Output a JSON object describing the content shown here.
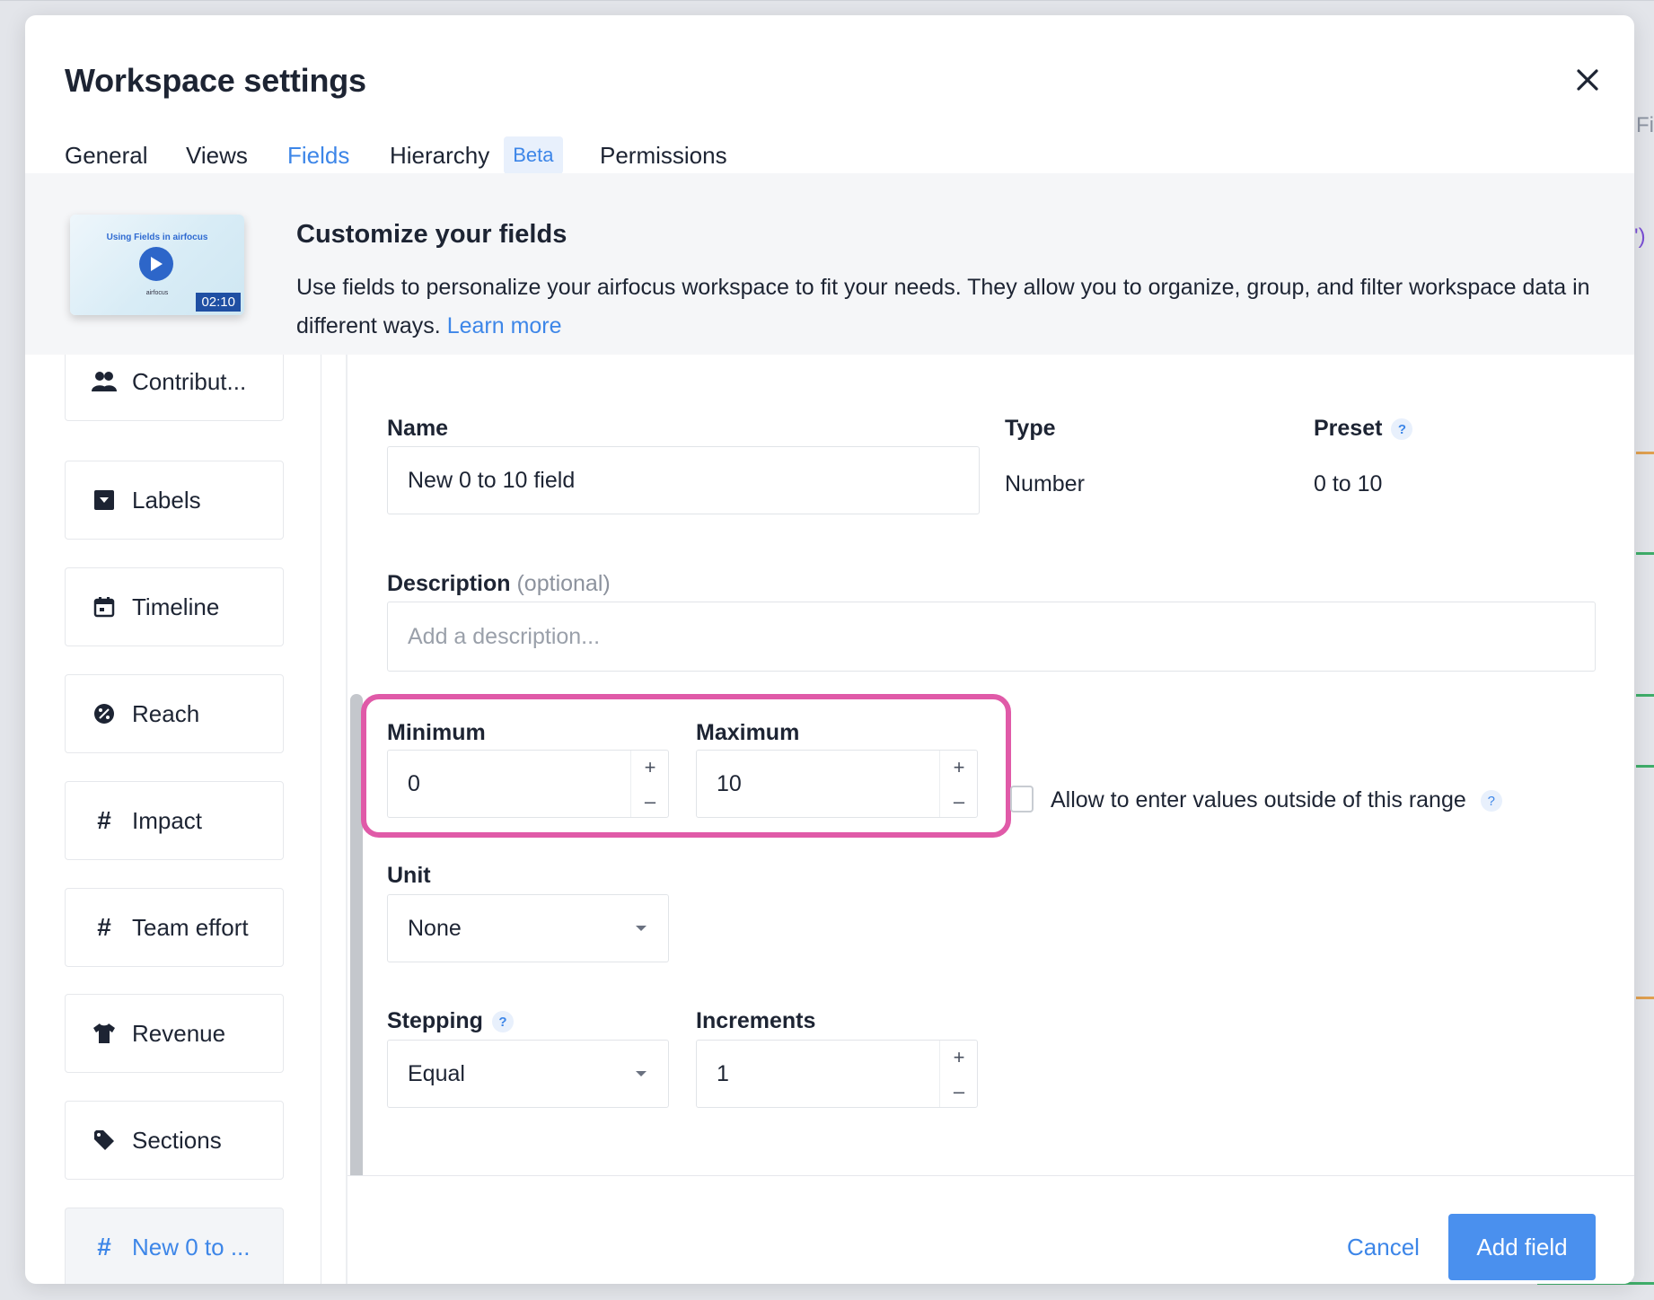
{
  "background": {
    "edge_text": "Fi",
    "edge_symbol": "')"
  },
  "modal": {
    "title": "Workspace settings",
    "close_icon": "close-x-icon"
  },
  "tabs": [
    {
      "label": "General",
      "active": false
    },
    {
      "label": "Views",
      "active": false
    },
    {
      "label": "Fields",
      "active": true
    },
    {
      "label": "Hierarchy",
      "active": false,
      "badge": "Beta"
    },
    {
      "label": "Permissions",
      "active": false
    }
  ],
  "intro": {
    "video": {
      "title": "Using Fields in airfocus",
      "brand": "airfocus",
      "duration": "02:10"
    },
    "title": "Customize your fields",
    "description": "Use fields to personalize your airfocus workspace to fit your needs. They allow you to organize, group, and filter workspace data in different ways.",
    "learn_more": "Learn more"
  },
  "sidebar": {
    "items": [
      {
        "label": "Contribut...",
        "icon": "people-icon",
        "active": false
      },
      {
        "label": "Labels",
        "icon": "dropdown-box-icon",
        "active": false
      },
      {
        "label": "Timeline",
        "icon": "calendar-icon",
        "active": false
      },
      {
        "label": "Reach",
        "icon": "percent-circle-icon",
        "active": false
      },
      {
        "label": "Impact",
        "icon": "hash-icon",
        "active": false
      },
      {
        "label": "Team effort",
        "icon": "hash-icon",
        "active": false
      },
      {
        "label": "Revenue",
        "icon": "shirt-icon",
        "active": false
      },
      {
        "label": "Sections",
        "icon": "tag-icon",
        "active": false
      },
      {
        "label": "New 0 to ...",
        "icon": "hash-icon",
        "active": true
      }
    ]
  },
  "form": {
    "name": {
      "label": "Name",
      "value": "New 0 to 10 field"
    },
    "type": {
      "label": "Type",
      "value": "Number"
    },
    "preset": {
      "label": "Preset",
      "help": "?",
      "value": "0 to 10"
    },
    "description": {
      "label": "Description",
      "optional": "(optional)",
      "placeholder": "Add a description..."
    },
    "minimum": {
      "label": "Minimum",
      "value": "0"
    },
    "maximum": {
      "label": "Maximum",
      "value": "10"
    },
    "allow_outside": {
      "label": "Allow to enter values outside of this range",
      "checked": false,
      "help": "?"
    },
    "unit": {
      "label": "Unit",
      "value": "None"
    },
    "stepping": {
      "label": "Stepping",
      "help": "?",
      "value": "Equal"
    },
    "increments": {
      "label": "Increments",
      "value": "1"
    },
    "stepper": {
      "plus": "+",
      "minus": "–"
    }
  },
  "footer": {
    "cancel_label": "Cancel",
    "add_label": "Add field"
  },
  "colors": {
    "accent": "#3d86e8",
    "primary_button": "#4a90ee",
    "highlight": "#e05aa8"
  }
}
